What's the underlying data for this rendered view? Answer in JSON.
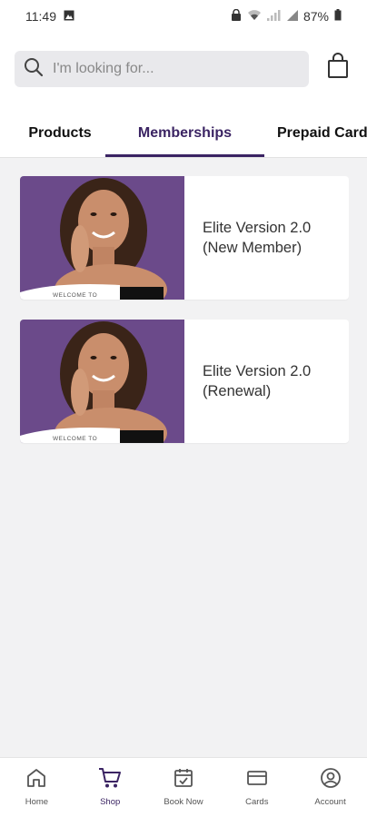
{
  "status_bar": {
    "time": "11:49",
    "battery": "87%"
  },
  "search": {
    "placeholder": "I'm looking for..."
  },
  "tabs": [
    {
      "label": "Products"
    },
    {
      "label": "Memberships"
    },
    {
      "label": "Prepaid Cards"
    }
  ],
  "active_tab": "Memberships",
  "cards": [
    {
      "title": "Elite Version 2.0\n(New Member)",
      "banner_text": "WELCOME TO"
    },
    {
      "title": "Elite Version 2.0\n(Renewal)",
      "banner_text": "WELCOME TO"
    }
  ],
  "bottom_nav": [
    {
      "label": "Home",
      "icon": "home-icon"
    },
    {
      "label": "Shop",
      "icon": "cart-icon"
    },
    {
      "label": "Book Now",
      "icon": "calendar-icon"
    },
    {
      "label": "Cards",
      "icon": "card-icon"
    },
    {
      "label": "Account",
      "icon": "account-icon"
    }
  ],
  "colors": {
    "accent": "#3b2463",
    "image_background": "#6b4a8a",
    "page_background": "#f2f2f3"
  }
}
